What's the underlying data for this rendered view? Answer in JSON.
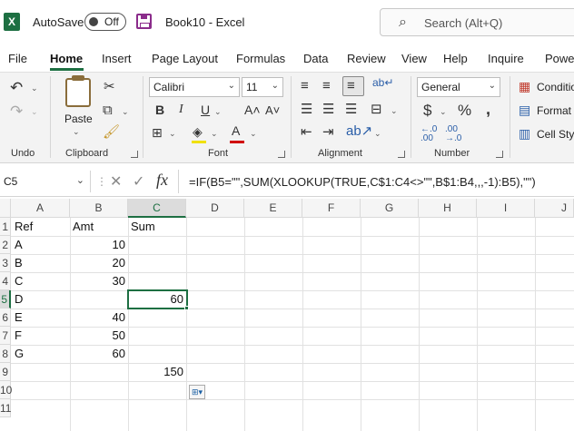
{
  "titlebar": {
    "autosave_label": "AutoSave",
    "toggle_state": "Off",
    "book_title": "Book10  -  Excel",
    "search_placeholder": "Search (Alt+Q)"
  },
  "tabs": [
    "File",
    "Home",
    "Insert",
    "Page Layout",
    "Formulas",
    "Data",
    "Review",
    "View",
    "Help",
    "Inquire",
    "Powe"
  ],
  "active_tab": "Home",
  "ribbon": {
    "groups": {
      "undo": "Undo",
      "clipboard": "Clipboard",
      "font": "Font",
      "alignment": "Alignment",
      "number": "Number"
    },
    "paste_label": "Paste",
    "font_name": "Calibri",
    "font_size": "11",
    "number_format": "General",
    "styles": [
      "Conditio",
      "Format",
      "Cell Styl"
    ]
  },
  "formula_bar": {
    "name_box": "C5",
    "formula": "=IF(B5=\"\",SUM(XLOOKUP(TRUE,C$1:C4<>\"\",B$1:B4,,,-1):B5),\"\")"
  },
  "grid": {
    "columns": [
      "A",
      "B",
      "C",
      "D",
      "E",
      "F",
      "G",
      "H",
      "I",
      "J"
    ],
    "selected_column": "C",
    "rows": [
      "1",
      "2",
      "3",
      "4",
      "5",
      "6",
      "7",
      "8",
      "9",
      "10",
      "11"
    ],
    "selected_row": "5",
    "cells": {
      "A1": "Ref",
      "B1": "Amt",
      "C1": "Sum",
      "A2": "A",
      "B2": "10",
      "A3": "B",
      "B3": "20",
      "A4": "C",
      "B4": "30",
      "A5": "D",
      "C5": "60",
      "A6": "E",
      "B6": "40",
      "A7": "F",
      "B7": "50",
      "A8": "G",
      "B8": "60",
      "C9": "150"
    }
  },
  "colors": {
    "excel_green": "#1d6f42",
    "save_purple": "#8b2c8b"
  }
}
